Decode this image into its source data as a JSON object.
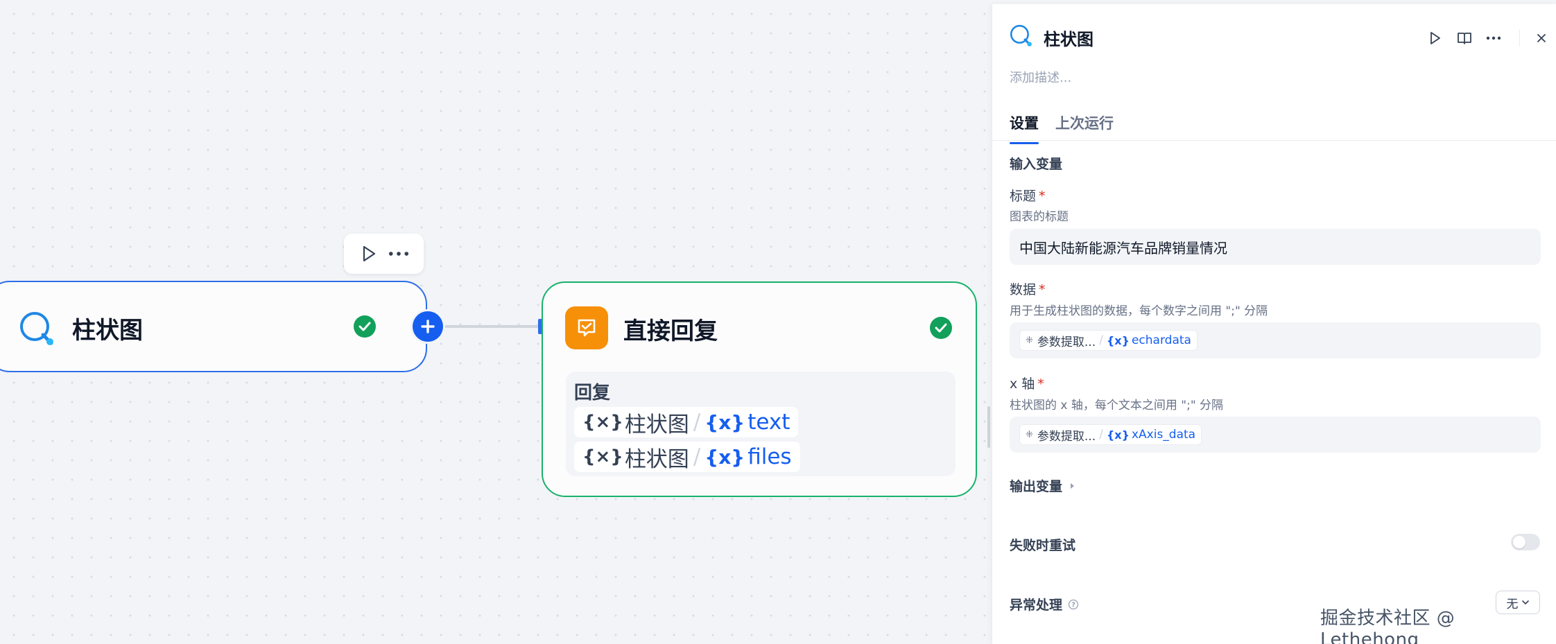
{
  "canvas": {
    "node1": {
      "title": "柱状图",
      "toolbar": {
        "run_icon": "play-icon",
        "more_icon": "more-icon"
      }
    },
    "node2": {
      "title": "直接回复",
      "reply_label": "回复",
      "vars": [
        {
          "symbol": "{×}",
          "node": "柱状图",
          "slash": "/",
          "var_symbol": "{x}",
          "var": "text"
        },
        {
          "symbol": "{×}",
          "node": "柱状图",
          "slash": "/",
          "var_symbol": "{x}",
          "var": "files"
        }
      ]
    }
  },
  "panel": {
    "title": "柱状图",
    "description_placeholder": "添加描述...",
    "tabs": [
      "设置",
      "上次运行"
    ],
    "input_section": "输入变量",
    "fields": {
      "title": {
        "label": "标题",
        "required": "*",
        "desc": "图表的标题",
        "value": "中国大陆新能源汽车品牌销量情况"
      },
      "data": {
        "label": "数据",
        "required": "*",
        "desc": "用于生成柱状图的数据，每个数字之间用 \";\" 分隔",
        "ref": {
          "icon": "⁜",
          "node": "参数提取...",
          "slash": "/",
          "var_symbol": "{x}",
          "var": "echardata"
        }
      },
      "xaxis": {
        "label": "x 轴",
        "required": "*",
        "desc": "柱状图的 x 轴，每个文本之间用 \";\" 分隔",
        "ref": {
          "icon": "⁜",
          "node": "参数提取...",
          "slash": "/",
          "var_symbol": "{x}",
          "var": "xAxis_data"
        }
      }
    },
    "output_section": "输出变量",
    "retry_label": "失败时重试",
    "error_label": "异常处理",
    "error_select": "无"
  },
  "watermark": "掘金技术社区 @ Lethehong",
  "colors": {
    "primary": "#155eef",
    "success": "#12a05a",
    "orange": "#f79009"
  }
}
